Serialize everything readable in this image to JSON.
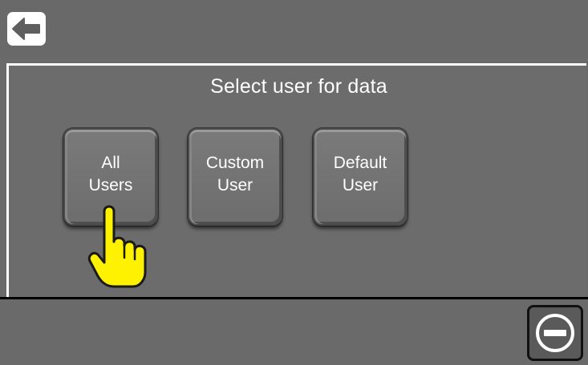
{
  "header": {
    "back_icon": "arrow-left-icon"
  },
  "panel": {
    "title": "Select user for data",
    "options": [
      {
        "label": "All\nUsers"
      },
      {
        "label": "Custom\nUser"
      },
      {
        "label": "Default\nUser"
      }
    ]
  },
  "footer": {
    "cancel_icon": "minus-circle-icon"
  },
  "overlay": {
    "pointer_icon": "hand-pointer-icon",
    "pointer_color": "#FFF200"
  },
  "colors": {
    "background": "#6A6A6A",
    "text": "#FFFFFF",
    "back_button_bg": "#FFFFFF"
  }
}
